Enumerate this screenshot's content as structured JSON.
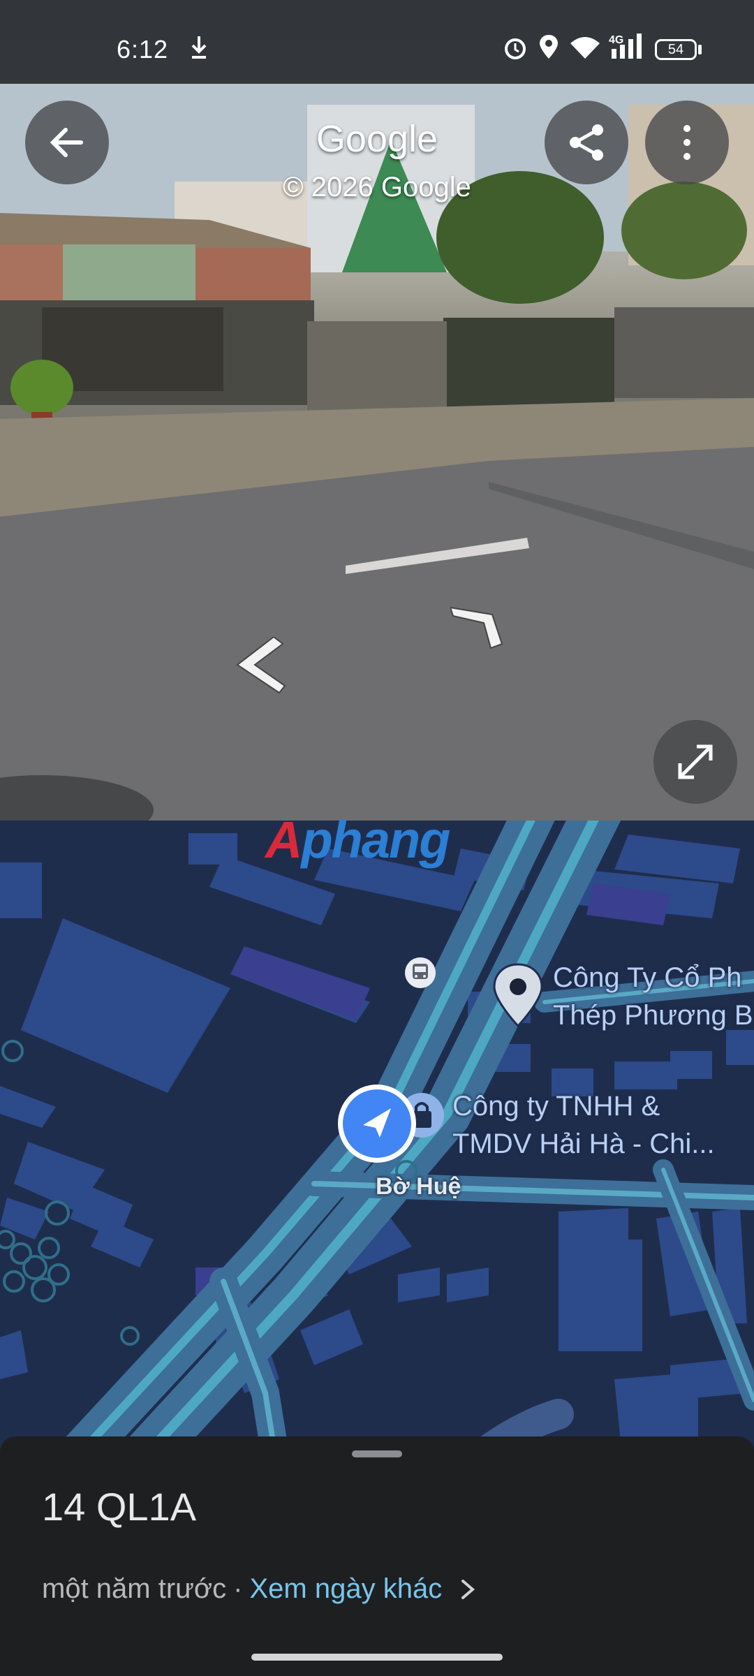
{
  "status_bar": {
    "time": "6:12",
    "icons": [
      "download-icon",
      "alarm-icon",
      "location-icon",
      "wifi-icon",
      "4g-signal-icon"
    ],
    "network": "4G",
    "battery": "54"
  },
  "street_view": {
    "title": "Google",
    "copyright": "© 2026 Google",
    "buttons": [
      "back-arrow-icon",
      "share-icon",
      "more-vert-icon",
      "fullscreen-icon"
    ]
  },
  "map": {
    "watermark_a": "A",
    "watermark_rest": "phang",
    "poi_1_line1": "Công Ty Cổ Ph",
    "poi_1_line2": "Thép Phương B",
    "poi_2_line1": "Công ty TNHH &",
    "poi_2_line2": "TMDV Hải Hà - Chi...",
    "road_label": "Bờ Huệ"
  },
  "sheet": {
    "title": "14 QL1A",
    "age": "một năm trước",
    "separator": "·",
    "other_date_link": "Xem ngày khác"
  },
  "colors": {
    "map_background": "#1f2d4d",
    "road": "#4ea8c4",
    "location_dot": "#4285f4",
    "link": "#78c6ec"
  }
}
